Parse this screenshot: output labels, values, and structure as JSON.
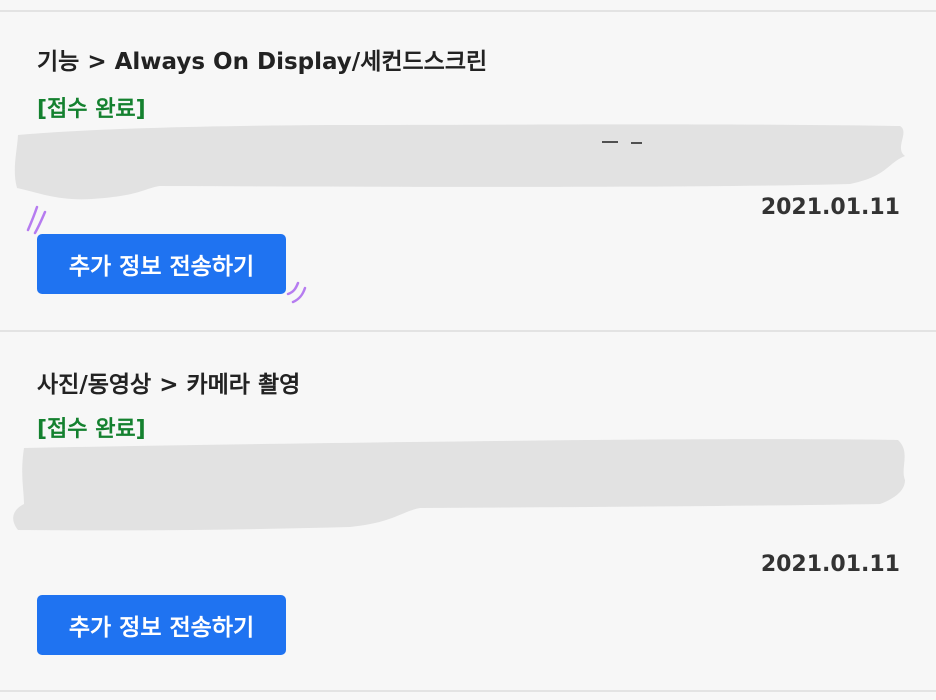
{
  "items": [
    {
      "category": "기능 > Always On Display/세컨드스크린",
      "status": "[접수 완료]",
      "date": "2021.01.11",
      "button_label": "추가 정보 전송하기"
    },
    {
      "category": "사진/동영상 > 카메라 촬영",
      "status": "[접수 완료]",
      "date": "2021.01.11",
      "button_label": "추가 정보 전송하기"
    }
  ],
  "colors": {
    "page_background": "#f7f7f7",
    "status_text": "#14812f",
    "button_background": "#1f73f1",
    "redaction": "#e2e2e2",
    "annotation_marks": "#b67cf0"
  }
}
